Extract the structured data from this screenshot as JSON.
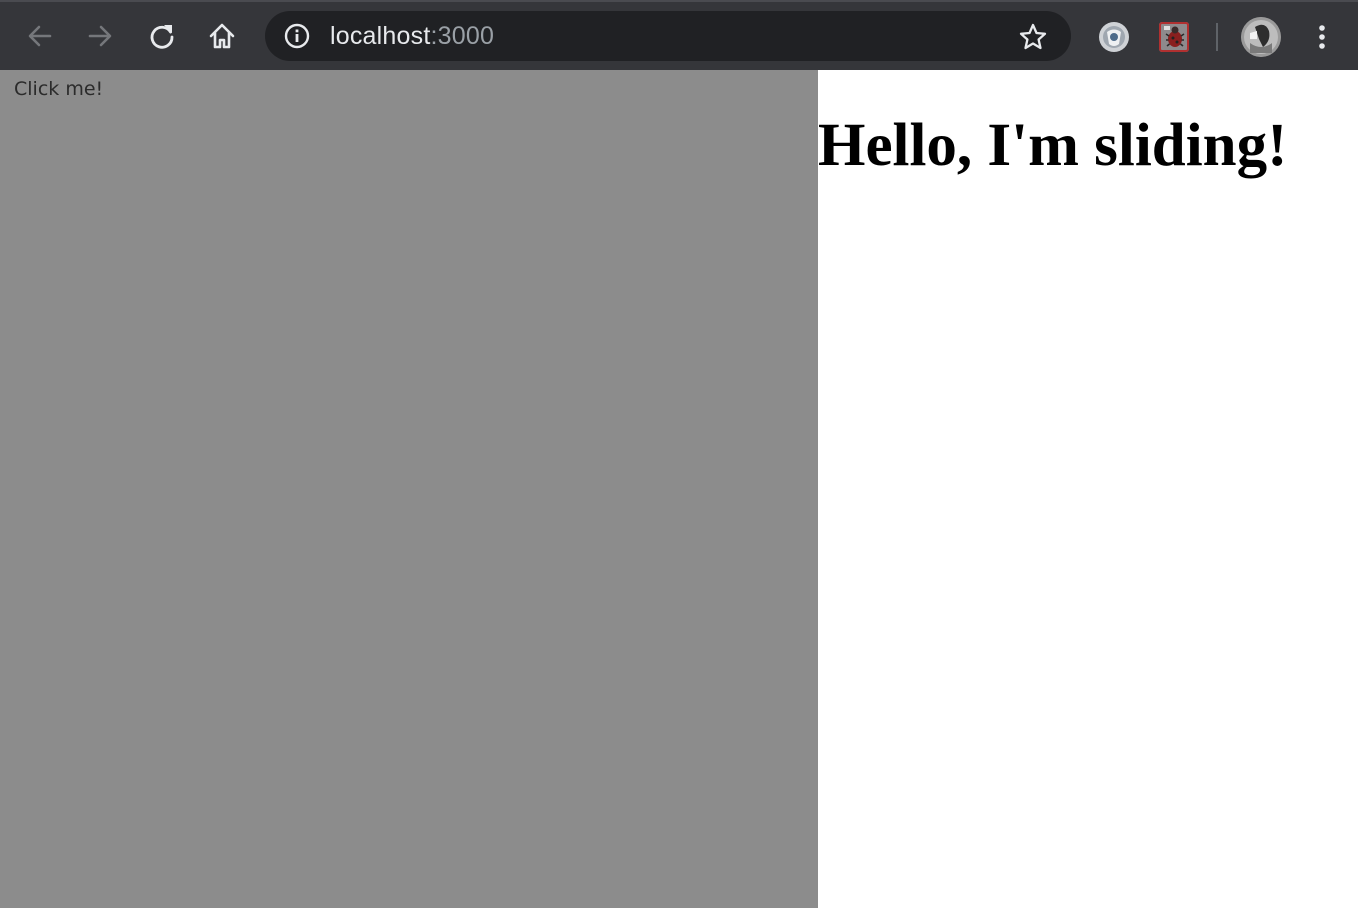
{
  "browser": {
    "url_host": "localhost",
    "url_port": ":3000",
    "icons": {
      "back": "arrow-left-icon",
      "forward": "arrow-right-icon",
      "reload": "reload-icon",
      "home": "home-icon",
      "site_info": "info-circle-icon",
      "bookmark": "star-icon",
      "extension_1": "extension-shield-icon",
      "extension_2": "extension-bug-icon",
      "profile": "avatar-icon",
      "menu": "kebab-menu-icon"
    },
    "colors": {
      "toolbar": "#35363a",
      "omnibox": "#202124",
      "url_host": "#e8eaed",
      "url_port": "#9aa0a6"
    }
  },
  "page": {
    "button_label": "Click me!",
    "heading": "Hello, I'm sliding!",
    "colors": {
      "overlay_panel": "#8c8c8c",
      "background": "#ffffff"
    }
  }
}
